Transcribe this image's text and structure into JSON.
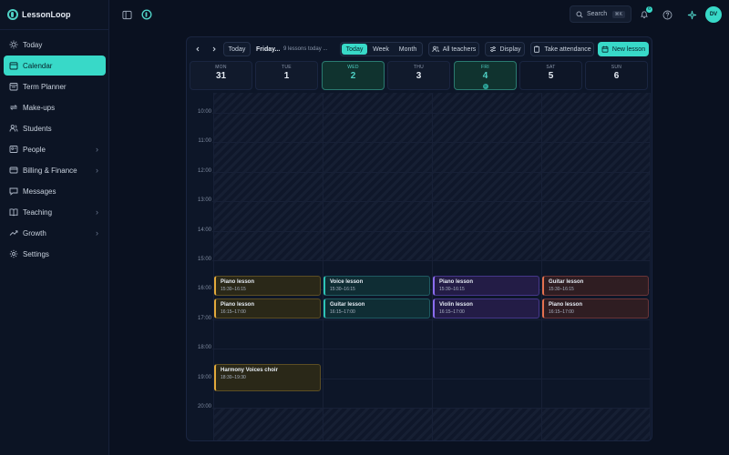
{
  "app": {
    "name": "LessonLoop"
  },
  "sidebar": {
    "items": [
      {
        "label": "Today",
        "icon": "sun-icon",
        "active": false,
        "chevron": false
      },
      {
        "label": "Calendar",
        "icon": "calendar-icon",
        "active": true,
        "chevron": false
      },
      {
        "label": "Term Planner",
        "icon": "planner-icon",
        "active": false,
        "chevron": false
      },
      {
        "label": "Make-ups",
        "icon": "repeat-icon",
        "active": false,
        "chevron": false
      },
      {
        "label": "Students",
        "icon": "users-icon",
        "active": false,
        "chevron": false
      },
      {
        "label": "People",
        "icon": "person-icon",
        "active": false,
        "chevron": true
      },
      {
        "label": "Billing & Finance",
        "icon": "billing-icon",
        "active": false,
        "chevron": true
      },
      {
        "label": "Messages",
        "icon": "message-icon",
        "active": false,
        "chevron": false
      },
      {
        "label": "Teaching",
        "icon": "book-icon",
        "active": false,
        "chevron": true
      },
      {
        "label": "Growth",
        "icon": "growth-icon",
        "active": false,
        "chevron": true
      },
      {
        "label": "Settings",
        "icon": "gear-icon",
        "active": false,
        "chevron": false
      }
    ]
  },
  "topbar": {
    "search_label": "Search",
    "search_shortcut": "⌘K",
    "notification_count": "6",
    "avatar_initials": "DV"
  },
  "toolbar": {
    "today_label": "Today",
    "date_label": "Friday...",
    "lessons_count": "9 lessons today",
    "lessons_ellipsis": "...",
    "views": [
      "Today",
      "Week",
      "Month"
    ],
    "active_view": "Today",
    "teachers_label": "All teachers",
    "display_label": "Display",
    "attendance_label": "Take attendance",
    "new_lesson_label": "New lesson"
  },
  "days": [
    {
      "name": "MON",
      "num": "31",
      "selected": false,
      "badge": ""
    },
    {
      "name": "TUE",
      "num": "1",
      "selected": false,
      "badge": ""
    },
    {
      "name": "WED",
      "num": "2",
      "selected": true,
      "badge": ""
    },
    {
      "name": "THU",
      "num": "3",
      "selected": false,
      "badge": ""
    },
    {
      "name": "FRI",
      "num": "4",
      "selected": true,
      "badge": "9"
    },
    {
      "name": "SAT",
      "num": "5",
      "selected": false,
      "badge": ""
    },
    {
      "name": "SUN",
      "num": "6",
      "selected": false,
      "badge": ""
    }
  ],
  "hours": [
    "10:00",
    "11:00",
    "12:00",
    "13:00",
    "14:00",
    "15:00",
    "16:00",
    "17:00",
    "18:00",
    "19:00",
    "20:00"
  ],
  "events": [
    {
      "col": 0,
      "start": 15.5,
      "end": 16.25,
      "title": "Piano lesson",
      "time": "15:30–16:15",
      "color": "amber"
    },
    {
      "col": 0,
      "start": 16.25,
      "end": 17.0,
      "title": "Piano lesson",
      "time": "16:15–17:00",
      "color": "amber"
    },
    {
      "col": 0,
      "start": 18.5,
      "end": 19.5,
      "title": "Harmony Voices choir",
      "time": "18:30–19:30",
      "color": "amber"
    },
    {
      "col": 1,
      "start": 15.5,
      "end": 16.25,
      "title": "Voice lesson",
      "time": "15:30–16:15",
      "color": "teal"
    },
    {
      "col": 1,
      "start": 16.25,
      "end": 17.0,
      "title": "Guitar lesson",
      "time": "16:15–17:00",
      "color": "teal"
    },
    {
      "col": 2,
      "start": 15.5,
      "end": 16.25,
      "title": "Piano lesson",
      "time": "15:30–16:15",
      "color": "purple"
    },
    {
      "col": 2,
      "start": 16.25,
      "end": 17.0,
      "title": "Violin lesson",
      "time": "16:15–17:00",
      "color": "purple"
    },
    {
      "col": 3,
      "start": 15.5,
      "end": 16.25,
      "title": "Guitar lesson",
      "time": "15:30–16:15",
      "color": "rose"
    },
    {
      "col": 3,
      "start": 16.25,
      "end": 17.0,
      "title": "Piano lesson",
      "time": "16:15–17:00",
      "color": "rose"
    }
  ],
  "colors": {
    "accent": "#38d9c8",
    "amber": "#e2a93b",
    "teal": "#2ec4b6",
    "purple": "#8b6cf0",
    "rose": "#e4714f"
  }
}
